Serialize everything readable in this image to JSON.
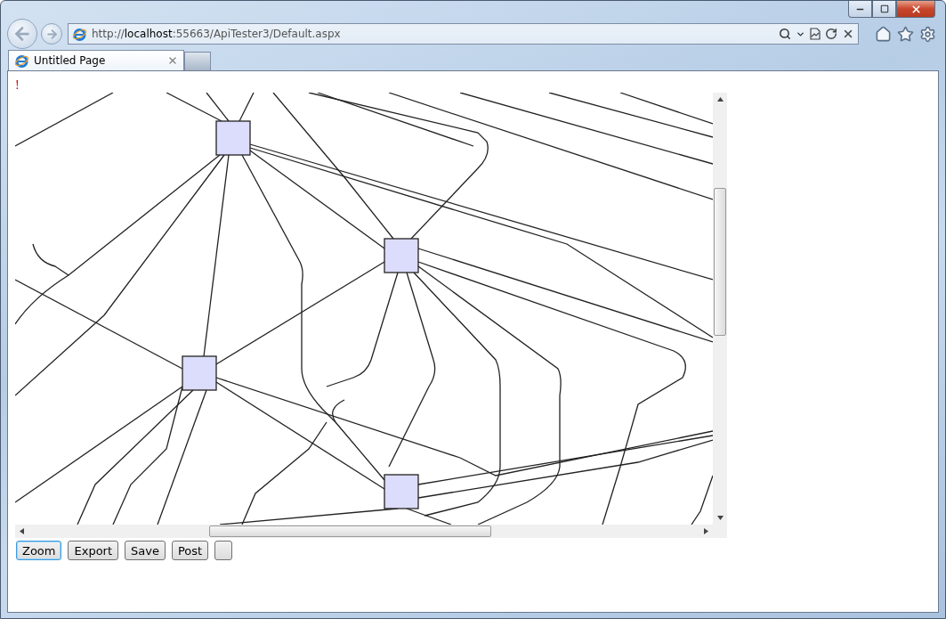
{
  "address_bar": {
    "url": "http://**localhost**:55663/ApiTester3/Default.aspx"
  },
  "tabs": [
    {
      "title": "Untitled Page",
      "selected": true
    }
  ],
  "page": {
    "notice": "!",
    "buttons": [
      {
        "label": "Zoom",
        "focused": true
      },
      {
        "label": "Export",
        "focused": false
      },
      {
        "label": "Save",
        "focused": false
      },
      {
        "label": "Post",
        "focused": false
      }
    ]
  }
}
